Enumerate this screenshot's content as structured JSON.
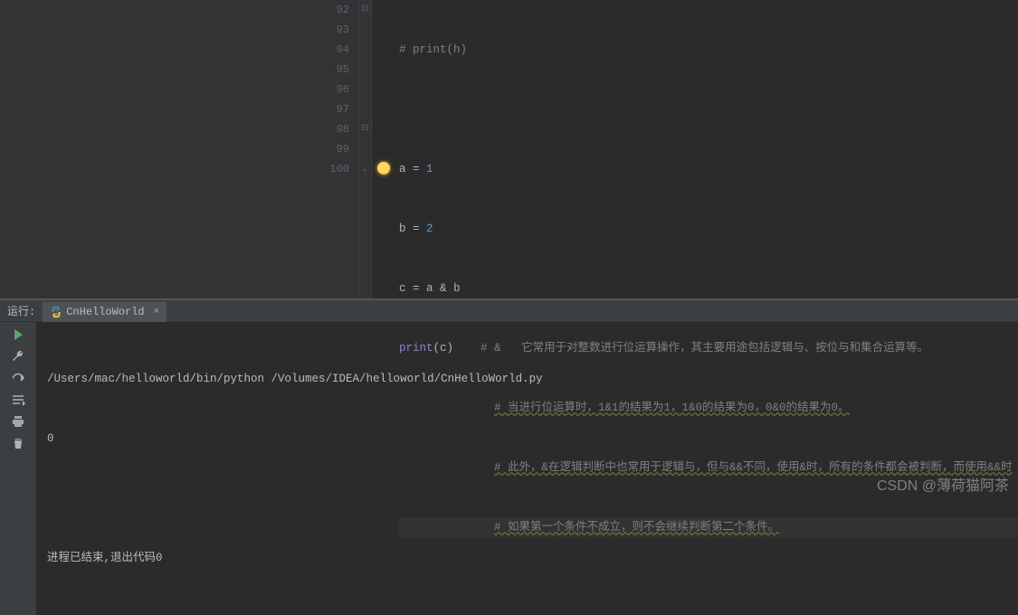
{
  "editor": {
    "line_numbers": [
      "92",
      "93",
      "94",
      "95",
      "96",
      "97",
      "98",
      "99",
      "100"
    ],
    "lines": {
      "l92_comment": "# print(h)",
      "l93": "",
      "l94_a": "a",
      "l94_eq": " = ",
      "l94_v": "1",
      "l95_b": "b",
      "l95_eq": " = ",
      "l95_v": "2",
      "l96_c": "c",
      "l96_eq": " = ",
      "l96_rhs_a": "a",
      "l96_amp": " & ",
      "l96_rhs_b": "b",
      "l97_print": "print",
      "l97_lp": "(",
      "l97_arg": "c",
      "l97_rp": ")",
      "l97_pad": "    ",
      "l97_cmt": "# &   它常用于对整数进行位运算操作，其主要用途包括逻辑与、按位与和集合运算等。",
      "l98_cmt": "# 当进行位运算时，1&1的结果为1，1&0的结果为0，0&0的结果为0。",
      "l99_cmt": "# 此外，&在逻辑判断中也常用于逻辑与，但与&&不同，使用&时，所有的条件都会被判断，而使用&&时",
      "l100_cmt": "# 如果第一个条件不成立，则不会继续判断第二个条件。"
    }
  },
  "run": {
    "label": "运行:",
    "tab_name": "CnHelloWorld",
    "cmd": "/Users/mac/helloworld/bin/python /Volumes/IDEA/helloworld/CnHelloWorld.py",
    "output": "0",
    "exit_msg": "进程已结束,退出代码0"
  },
  "watermark": "CSDN @薄荷猫阿茶",
  "icons": {
    "python": "python-icon",
    "close": "close-icon",
    "play": "play-icon",
    "wrench": "wrench-icon",
    "step_into": "step-into-icon",
    "step_over": "step-over-icon",
    "print": "print-icon",
    "trash": "trash-icon"
  }
}
